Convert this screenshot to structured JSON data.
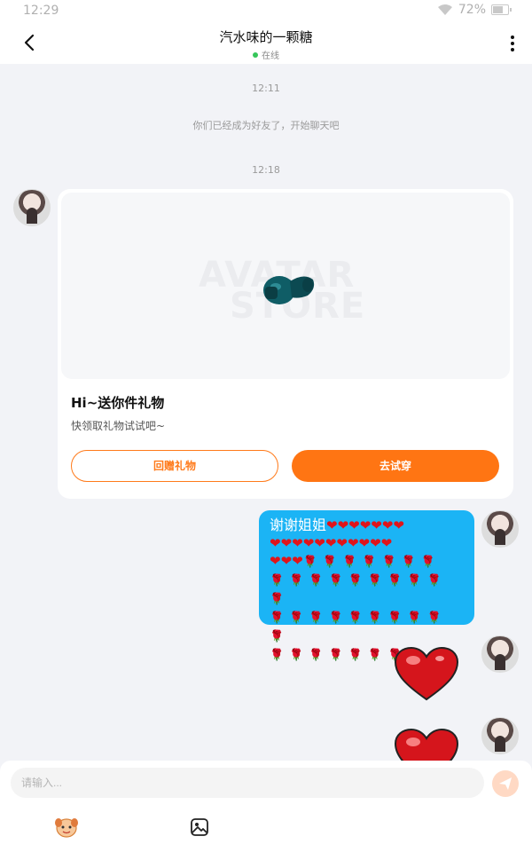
{
  "status_bar": {
    "time": "12:29",
    "battery": "72%"
  },
  "header": {
    "title": "汽水味的一颗糖",
    "status": "在线"
  },
  "messages": {
    "timestamp_1": "12:11",
    "system_notice": "你们已经成为好友了，开始聊天吧",
    "timestamp_2": "12:18",
    "gift_card": {
      "watermark_line1": "AVATAR",
      "watermark_line2": "STORE",
      "title": "Hi~送你件礼物",
      "subtitle": "快领取礼物试试吧~",
      "return_gift_label": "回赠礼物",
      "try_on_label": "去试穿"
    },
    "text_message": {
      "text": "谢谢姐姐",
      "heart_emoji": "❤️",
      "rose_emoji": "🌹"
    }
  },
  "composer": {
    "placeholder": "请输入..."
  },
  "colors": {
    "accent": "#ff7513",
    "bubble": "#1bb4f5",
    "online": "#36c65a"
  }
}
